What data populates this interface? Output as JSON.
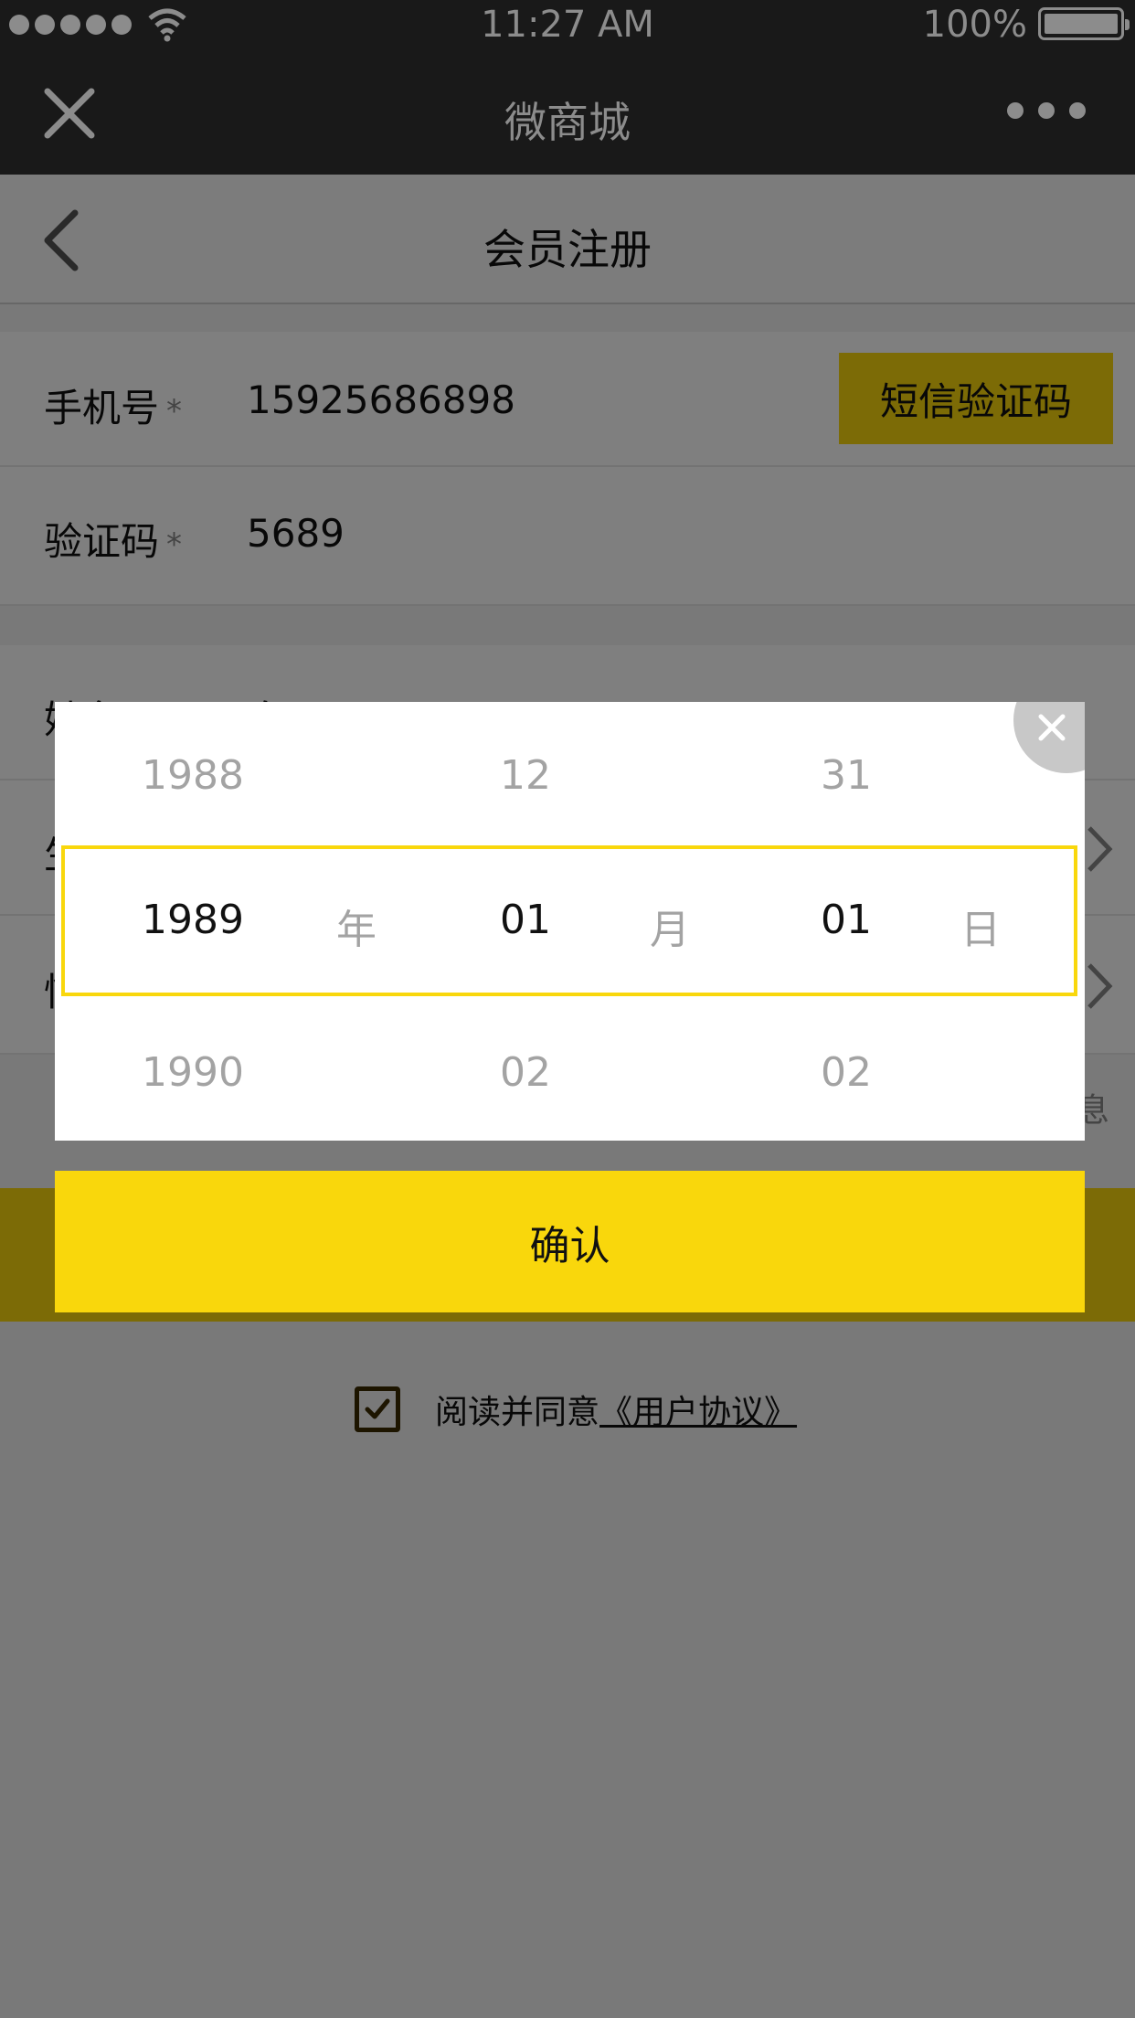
{
  "status_bar": {
    "time": "11:27 AM",
    "battery": "100%"
  },
  "wechat_nav": {
    "title": "微商城"
  },
  "header": {
    "title": "会员注册"
  },
  "form": {
    "phone": {
      "label": "手机号",
      "required_mark": "*",
      "value": "15925686898",
      "sms_button": "短信验证码"
    },
    "code": {
      "label": "验证码",
      "required_mark": "*",
      "value": "5689"
    },
    "name": {
      "label_partial": "姓名",
      "value_partial": "白云飘飘"
    },
    "birthday": {
      "label_partial": "生"
    },
    "gender": {
      "label_partial": "性"
    },
    "tip_partial": "息"
  },
  "agreement": {
    "text": "阅读并同意",
    "link": "《用户协议》"
  },
  "picker": {
    "years": [
      "1988",
      "1989",
      "1990"
    ],
    "months": [
      "12",
      "01",
      "02"
    ],
    "days": [
      "31",
      "01",
      "02"
    ],
    "units": {
      "year": "年",
      "month": "月",
      "day": "日"
    },
    "confirm_label": "确认"
  }
}
